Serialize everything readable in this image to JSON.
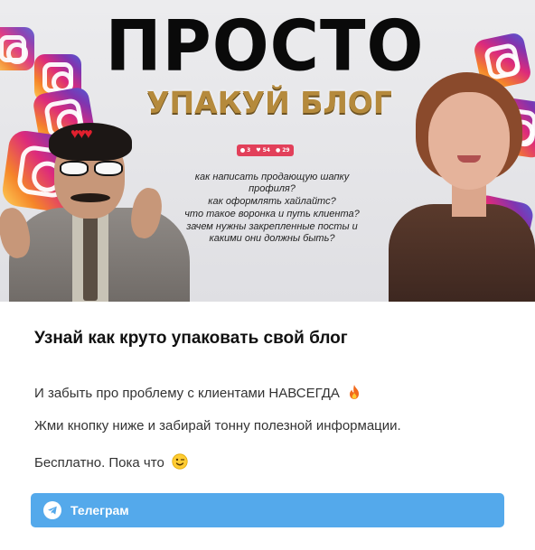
{
  "banner": {
    "headline": "ПРОСТО",
    "subline": "УПАКУЙ БЛОГ",
    "stats": {
      "comments": "3",
      "likes": "54",
      "followers": "29"
    },
    "questions": [
      "как написать продающую шапку профиля?",
      "как оформлять хайлайтс?",
      "что такое воронка и путь клиента?",
      "зачем нужны закрепленные посты и какими они должны быть?"
    ],
    "icons": [
      "instagram-logo-icon",
      "hearts-icon"
    ]
  },
  "post": {
    "title": "Узнай как круто упаковать свой блог",
    "paragraph_1": "И забыть про проблему с клиентами НАВСЕГДА",
    "paragraph_2": "Жми кнопку ниже и забирай тонну полезной информации.",
    "paragraph_3": "Бесплатно. Пока что",
    "emoji_1": "fire-icon",
    "emoji_2": "wink-face-icon"
  },
  "cta": {
    "label": "Телеграм",
    "icon": "telegram-icon",
    "color": "#54a9eb"
  }
}
